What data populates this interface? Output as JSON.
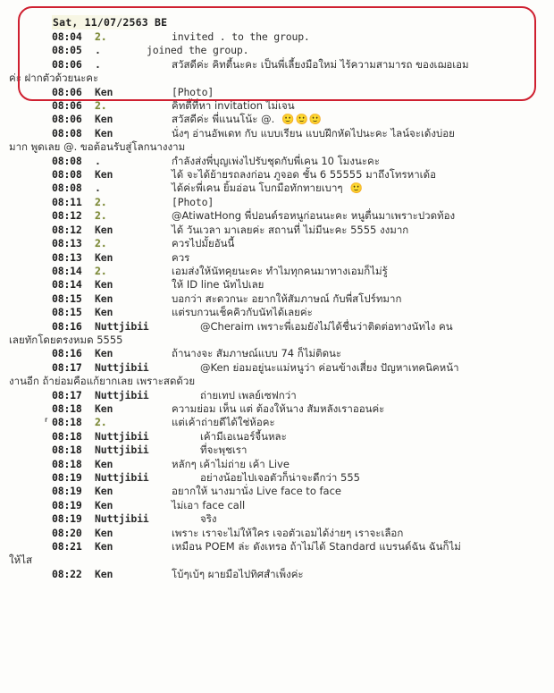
{
  "document": {
    "type": "chat-transcript-screenshot",
    "date_header": "Sat, 11/07/2563 BE",
    "annotation": {
      "shape": "rounded-rectangle",
      "color": "#cf2030",
      "covers_rows": 5
    }
  },
  "senders": {
    "redacted_short": "2.",
    "dot": ".",
    "ken": "Ken",
    "nuttjibii": "Nuttjibii"
  },
  "messages": [
    {
      "time": "08:04",
      "sender": "2.",
      "sender_kind": "redacted",
      "text": "invited . to the group.",
      "style": "mono",
      "in_box": true
    },
    {
      "time": "08:05",
      "sender": ".",
      "sender_kind": "dot",
      "text": "joined the group.",
      "style": "mono",
      "in_box": true,
      "inline_sender": true
    },
    {
      "time": "08:06",
      "sender": ".",
      "sender_kind": "dot",
      "text": "สวัสดีค่ะ คิทตี้นะคะ เป็นพี่เลี้ยงมือใหม่ ไร้ความสามารถ ของเฌอเอม",
      "continuation": "ค่ะ ฝากตัวด้วยนะคะ",
      "style": "thai",
      "in_box": true
    },
    {
      "time": "08:06",
      "sender": "Ken",
      "sender_kind": "name",
      "text": "[Photo]",
      "style": "mono",
      "in_box": true
    },
    {
      "time": "08:06",
      "sender": "2.",
      "sender_kind": "redacted",
      "text": "คิทตี้ที่หา invitation ไม่เจน",
      "style": "thai"
    },
    {
      "time": "08:06",
      "sender": "Ken",
      "sender_kind": "name",
      "text": "สวัสดีค่ะ พี่แนนโน้ะ @.",
      "emoji": "🙂🙂🙂",
      "style": "thai"
    },
    {
      "time": "08:08",
      "sender": "Ken",
      "sender_kind": "name",
      "text": "นั่งๆ อ่านอัพเดท กับ แบบเรียน แบบฝึกหัดไปนะคะ   ไลน์จะเด้งบ่อย",
      "continuation": "มาก พูดเลย @. ขอต้อนรับสู่โลกนางงาม",
      "style": "thai"
    },
    {
      "time": "08:08",
      "sender": ".",
      "sender_kind": "dot",
      "text": "กำลังส่งพี่บุญเพ่งไปรับชุดกับพี่เคน 10 โมงนะคะ",
      "style": "thai"
    },
    {
      "time": "08:08",
      "sender": "Ken",
      "sender_kind": "name",
      "text": "ได้ จะได้ย้ายรถลงก่อน ภูจอด ชั้น 6 55555 มาถึงโทรหาเด้อ",
      "style": "thai"
    },
    {
      "time": "08:08",
      "sender": ".",
      "sender_kind": "dot",
      "text": "ได้ค่ะพี่เคน ยิ้มอ่อน โบกมือทักทายเบาๆ",
      "emoji": "🙂",
      "style": "thai"
    },
    {
      "time": "08:11",
      "sender": "2.",
      "sender_kind": "redacted",
      "text": "[Photo]",
      "style": "mono"
    },
    {
      "time": "08:12",
      "sender": "2.",
      "sender_kind": "redacted",
      "text": "@AtiwatHong พี่ปอนด์รอหนูก่อนนะคะ หนูตื่นมาเพราะปวดท้อง",
      "style": "thai"
    },
    {
      "time": "08:12",
      "sender": "Ken",
      "sender_kind": "name",
      "text": "ได้ วันเวลา มาเลยค่ะ สถานที่ ไม่มีนะคะ 5555 งงมาก",
      "style": "thai"
    },
    {
      "time": "08:13",
      "sender": "2.",
      "sender_kind": "redacted",
      "text": "ควรไปมั้ยอันนี้",
      "style": "thai"
    },
    {
      "time": "08:13",
      "sender": "Ken",
      "sender_kind": "name",
      "text": "ควร",
      "style": "thai"
    },
    {
      "time": "08:14",
      "sender": "2.",
      "sender_kind": "redacted",
      "text": "เอมส่งให้นัทคุยนะคะ ทำไมทุกคนมาทางเอมก็ไม่รู้",
      "style": "thai"
    },
    {
      "time": "08:14",
      "sender": "Ken",
      "sender_kind": "name",
      "text": "ให้ ID line นัทไปเลย",
      "style": "thai"
    },
    {
      "time": "08:15",
      "sender": "Ken",
      "sender_kind": "name",
      "text": "บอกว่า สะดวกนะ อยากให้สัมภาษณ์ กับพี่สโปร์ทมาก",
      "style": "thai"
    },
    {
      "time": "08:15",
      "sender": "Ken",
      "sender_kind": "name",
      "text": "แต่รบกวนเช็คคิวกับนัทได้เลยค่ะ",
      "style": "thai"
    },
    {
      "time": "08:16",
      "sender": "Nuttjibii",
      "sender_kind": "name",
      "text": "@Cheraim เพราะพี่เอมยังไม่ได้ชื่นว่าติดต่อทางนัทไง คน",
      "continuation": "เลยทักโดยตรงหมด 5555",
      "style": "thai",
      "wide": true
    },
    {
      "time": "08:16",
      "sender": "Ken",
      "sender_kind": "name",
      "text": "ถ้านางจะ สัมภาษณ์แบบ 74 ก็ไม่ติดนะ",
      "style": "thai"
    },
    {
      "time": "08:17",
      "sender": "Nuttjibii",
      "sender_kind": "name",
      "text": "@Ken ย่อมอยู่นะแม่หนูว่า ค่อนข้างเสี่ยง ปัญหาเทคนิคหน้า",
      "continuation": "งานอีก ถ้าย่อมคือแก้ยากเลย เพราะสดด้วย",
      "style": "thai",
      "wide": true
    },
    {
      "time": "08:17",
      "sender": "Nuttjibii",
      "sender_kind": "name",
      "text": "ถ่ายเทป เพลย์เซฟกว่า",
      "style": "thai",
      "wide": true
    },
    {
      "time": "08:18",
      "sender": "Ken",
      "sender_kind": "name",
      "text": "ความย่อม เห็น แต่ ต้องให้นาง สัมหลังเราออนค่ะ",
      "style": "thai"
    },
    {
      "time": "08:18",
      "sender": "2.",
      "sender_kind": "redacted",
      "text": "แต่เค้าถ่ายดีได้ใช่ห้อคะ",
      "style": "thai",
      "tick": true
    },
    {
      "time": "08:18",
      "sender": "Nuttjibii",
      "sender_kind": "name",
      "text": "เค้ามีเอเนอร์จี้นหละ",
      "style": "thai",
      "wide": true
    },
    {
      "time": "08:18",
      "sender": "Nuttjibii",
      "sender_kind": "name",
      "text": "ที่จะพุชเรา",
      "style": "thai",
      "wide": true
    },
    {
      "time": "08:18",
      "sender": "Ken",
      "sender_kind": "name",
      "text": "หลักๆ เค้าไม่ถ่าย เค้า Live",
      "style": "thai"
    },
    {
      "time": "08:19",
      "sender": "Nuttjibii",
      "sender_kind": "name",
      "text": "อย่างน้อยไปเจอตัวก็น่าจะดีกว่า 555",
      "style": "thai",
      "wide": true
    },
    {
      "time": "08:19",
      "sender": "Ken",
      "sender_kind": "name",
      "text": "อยากให้ นางมานั่ง Live face to face",
      "style": "thai"
    },
    {
      "time": "08:19",
      "sender": "Ken",
      "sender_kind": "name",
      "text": "ไม่เอา face call",
      "style": "thai"
    },
    {
      "time": "08:19",
      "sender": "Nuttjibii",
      "sender_kind": "name",
      "text": "จริง",
      "style": "thai",
      "wide": true
    },
    {
      "time": "08:20",
      "sender": "Ken",
      "sender_kind": "name",
      "text": "เพราะ เราจะไม่ให้ใคร เจอตัวเอมได้ง่ายๆ เราจะเลือก",
      "style": "thai"
    },
    {
      "time": "08:21",
      "sender": "Ken",
      "sender_kind": "name",
      "text": "เหมือน POEM ล่ะ ดังเทรอ ถ้าไม่ได้ Standard แบรนด์ฉัน ฉันก็ไม่",
      "continuation": "ให้ไส",
      "style": "thai"
    },
    {
      "time": "08:22",
      "sender": "Ken",
      "sender_kind": "name",
      "text": "โบ้ๆเบ้ๆ ผายมือไปทิศสำเพ็งค่ะ",
      "style": "thai"
    }
  ]
}
